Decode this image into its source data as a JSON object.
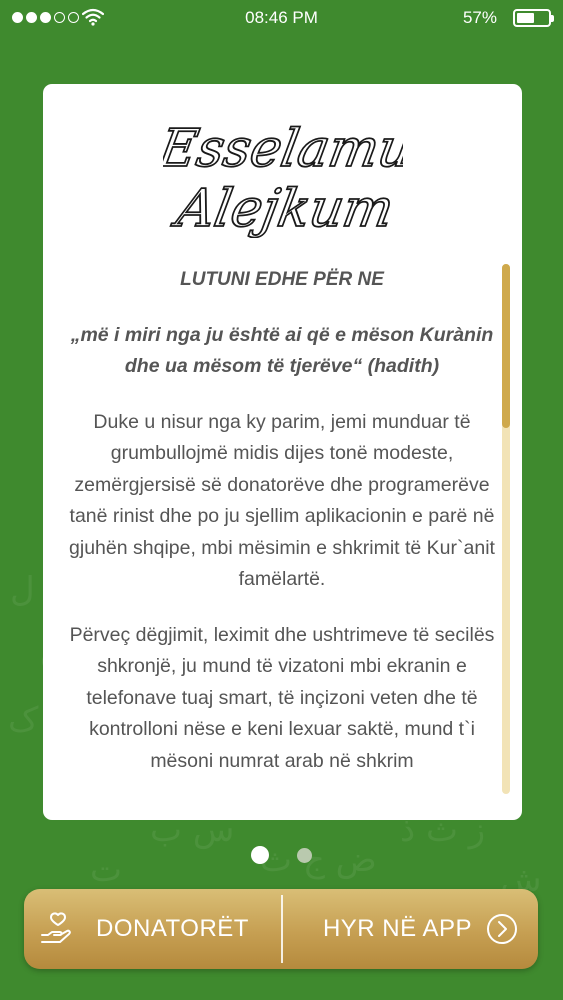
{
  "status_bar": {
    "time": "08:46 PM",
    "battery_percent": "57%",
    "battery_level": 0.57,
    "signal_bars_filled": 3,
    "signal_bars_total": 5,
    "icons": [
      "signal-dots-icon",
      "wifi-icon",
      "battery-icon"
    ]
  },
  "card": {
    "logo_line1": "Esselamu",
    "logo_line2": "Alejkum",
    "heading": "LUTUNI EDHE PËR NE",
    "quote": "„më i miri nga ju është ai që e mëson Kurànin dhe ua mësom të tjerëve“ (hadith)",
    "paragraph1": "Duke u nisur nga ky parim, jemi munduar të grumbullojmë midis dijes tonë modeste, zemërgjersisë së donatorëve dhe programerëve tanë rinist dhe po ju sjellim aplikacionin e parë në gjuhën shqipe, mbi mësimin e shkrimit të Kur`anit famëlartë.",
    "paragraph2": "Përveç dëgjimit, leximit dhe ushtrimeve të secilës shkronjë, ju mund të vizatoni mbi ekranin e telefonave tuaj smart, të inçizoni veten dhe të kontrolloni nëse e keni lexuar saktë, mund t`i mësoni numrat arab në shkrim",
    "scroll_position": 0.0,
    "scroll_visible_fraction": 0.31
  },
  "pagination": {
    "current_page": 1,
    "total_pages": 2
  },
  "actions": {
    "donate_label": "DONATORËT",
    "enter_label": "HYR NË APP",
    "donate_icon": "hand-heart-icon",
    "enter_icon": "chevron-right-circle-icon"
  },
  "colors": {
    "background": "#3f8a2e",
    "gold": "#c69f52",
    "scroll_thumb": "#cfa94c",
    "scroll_track": "#f2e3b6"
  }
}
